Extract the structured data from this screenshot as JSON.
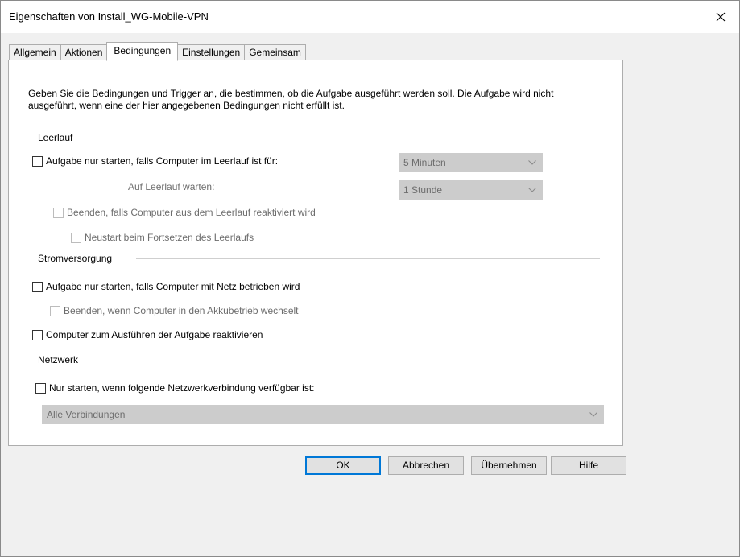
{
  "window": {
    "title": "Eigenschaften von Install_WG-Mobile-VPN"
  },
  "tabs": [
    {
      "label": "Allgemein"
    },
    {
      "label": "Aktionen"
    },
    {
      "label": "Bedingungen"
    },
    {
      "label": "Einstellungen"
    },
    {
      "label": "Gemeinsam"
    }
  ],
  "description": "Geben Sie die Bedingungen und Trigger an, die bestimmen, ob die Aufgabe ausgeführt werden soll. Die Aufgabe wird nicht ausgeführt, wenn eine der hier angegebenen Bedingungen nicht erfüllt ist.",
  "idle": {
    "group_label": "Leerlauf",
    "start_only_if_idle": {
      "label": "Aufgabe nur starten, falls Computer im Leerlauf ist für:",
      "checked": false
    },
    "idle_duration": {
      "value": "5 Minuten"
    },
    "wait_label": "Auf Leerlauf warten:",
    "wait_duration": {
      "value": "1 Stunde"
    },
    "stop_if_resume": {
      "label": "Beenden, falls Computer aus dem Leerlauf reaktiviert wird",
      "checked": false
    },
    "restart_on_idle": {
      "label": "Neustart beim Fortsetzen des Leerlaufs",
      "checked": false
    }
  },
  "power": {
    "group_label": "Stromversorgung",
    "ac_only": {
      "label": "Aufgabe nur starten, falls Computer mit Netz betrieben wird",
      "checked": false
    },
    "stop_on_battery": {
      "label": "Beenden, wenn Computer in den Akkubetrieb wechselt",
      "checked": false
    },
    "wake_to_run": {
      "label": "Computer zum Ausführen der Aufgabe reaktivieren",
      "checked": false
    }
  },
  "network": {
    "group_label": "Netzwerk",
    "only_if_network": {
      "label": "Nur starten, wenn folgende Netzwerkverbindung verfügbar ist:",
      "checked": false
    },
    "connection": {
      "value": "Alle Verbindungen"
    }
  },
  "buttons": {
    "ok": "OK",
    "cancel": "Abbrechen",
    "apply": "Übernehmen",
    "help": "Hilfe"
  },
  "colors": {
    "default_button_border": "#0078d7",
    "disabled_combo": "#cccccc"
  }
}
